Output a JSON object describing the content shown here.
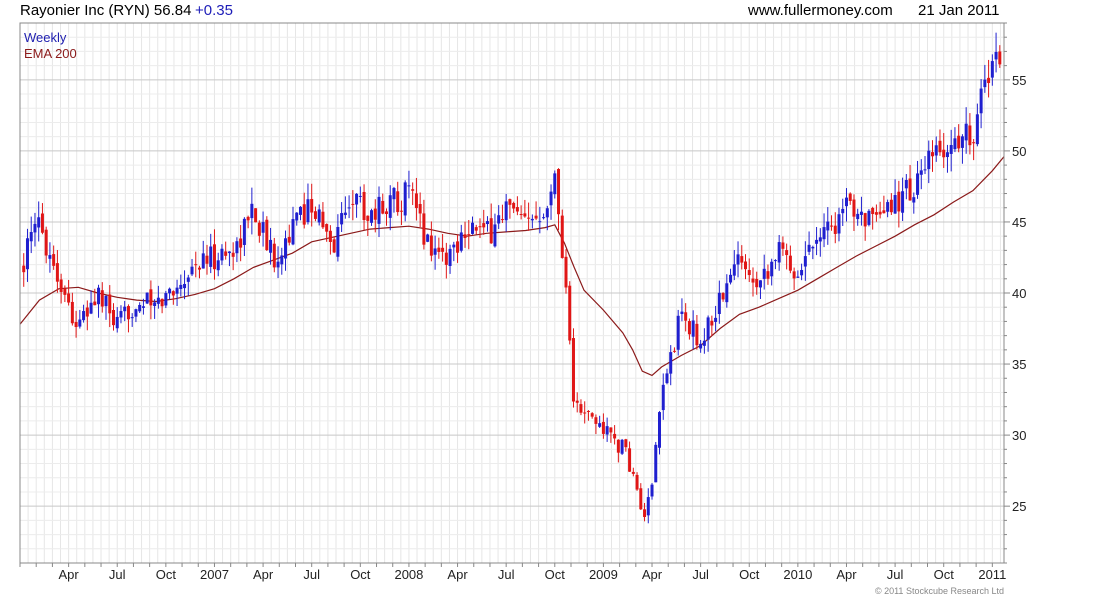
{
  "header": {
    "title": "Rayonier Inc (RYN) 56.84",
    "change": "+0.35",
    "site": "www.fullermoney.com",
    "date": "21 Jan 2011"
  },
  "footer": {
    "copyright": "© 2011 Stockcube Research Ltd"
  },
  "colors": {
    "up": "#1f1fcf",
    "down": "#e01616",
    "ema": "#8b1a1a",
    "grid": "#d4d4d4",
    "legend_weekly": "#2020b0"
  },
  "chart_data": {
    "type": "candlestick",
    "title": "Rayonier Inc (RYN) 56.84 +0.35",
    "legend": [
      "Weekly",
      "EMA 200"
    ],
    "legend_position": "top-left",
    "grid": true,
    "ylim": [
      21,
      59
    ],
    "yticks": [
      25,
      30,
      35,
      40,
      45,
      50,
      55
    ],
    "xticks": [
      "Apr",
      "Jul",
      "Oct",
      "2007",
      "Apr",
      "Jul",
      "Oct",
      "2008",
      "Apr",
      "Jul",
      "Oct",
      "2009",
      "Apr",
      "Jul",
      "Oct",
      "2010",
      "Apr",
      "Jul",
      "Oct",
      "2011"
    ],
    "xtick_times": [
      2006.25,
      2006.5,
      2006.75,
      2007.0,
      2007.25,
      2007.5,
      2007.75,
      2008.0,
      2008.25,
      2008.5,
      2008.75,
      2009.0,
      2009.25,
      2009.5,
      2009.75,
      2010.0,
      2010.25,
      2010.5,
      2010.75,
      2011.0
    ],
    "xlim": [
      2006.0,
      2011.06
    ],
    "price_series": {
      "name": "Weekly",
      "times": [
        2006.0,
        2006.1,
        2006.2,
        2006.3,
        2006.4,
        2006.5,
        2006.6,
        2006.7,
        2006.8,
        2006.9,
        2007.0,
        2007.1,
        2007.2,
        2007.3,
        2007.4,
        2007.5,
        2007.6,
        2007.7,
        2007.8,
        2007.9,
        2008.0,
        2008.1,
        2008.2,
        2008.3,
        2008.4,
        2008.5,
        2008.6,
        2008.7,
        2008.75,
        2008.8,
        2008.85,
        2008.9,
        2009.0,
        2009.1,
        2009.15,
        2009.2,
        2009.25,
        2009.3,
        2009.4,
        2009.5,
        2009.6,
        2009.7,
        2009.8,
        2009.9,
        2010.0,
        2010.1,
        2010.2,
        2010.3,
        2010.4,
        2010.5,
        2010.6,
        2010.7,
        2010.8,
        2010.9,
        2011.0,
        2011.06
      ],
      "close": [
        41.8,
        45.0,
        41.0,
        37.5,
        40.0,
        37.5,
        39.5,
        39.0,
        40.5,
        42.0,
        42.5,
        43.0,
        46.0,
        42.5,
        44.5,
        46.5,
        43.0,
        47.0,
        45.5,
        46.5,
        47.0,
        43.5,
        42.5,
        45.0,
        44.0,
        46.0,
        44.5,
        46.5,
        48.0,
        42.0,
        32.0,
        31.5,
        30.5,
        29.0,
        27.5,
        24.0,
        26.0,
        33.0,
        38.5,
        36.5,
        39.5,
        42.5,
        41.0,
        43.0,
        41.5,
        44.5,
        45.0,
        46.5,
        44.5,
        46.5,
        47.5,
        49.5,
        50.5,
        51.5,
        56.5,
        56.8
      ]
    },
    "ema_series": {
      "name": "EMA 200",
      "times": [
        2006.0,
        2006.1,
        2006.2,
        2006.3,
        2006.4,
        2006.5,
        2006.6,
        2006.7,
        2006.8,
        2006.9,
        2007.0,
        2007.1,
        2007.2,
        2007.3,
        2007.4,
        2007.5,
        2007.6,
        2007.7,
        2007.8,
        2007.9,
        2008.0,
        2008.1,
        2008.2,
        2008.3,
        2008.4,
        2008.5,
        2008.6,
        2008.7,
        2008.75,
        2008.8,
        2008.85,
        2008.9,
        2009.0,
        2009.1,
        2009.15,
        2009.2,
        2009.25,
        2009.3,
        2009.4,
        2009.5,
        2009.6,
        2009.7,
        2009.8,
        2009.9,
        2010.0,
        2010.1,
        2010.2,
        2010.3,
        2010.4,
        2010.5,
        2010.6,
        2010.7,
        2010.8,
        2010.9,
        2011.0,
        2011.06
      ],
      "values": [
        37.8,
        39.5,
        40.3,
        40.4,
        40.0,
        39.7,
        39.5,
        39.4,
        39.6,
        39.9,
        40.3,
        41.0,
        41.8,
        42.3,
        42.8,
        43.6,
        43.9,
        44.2,
        44.5,
        44.6,
        44.7,
        44.5,
        44.2,
        44.0,
        44.2,
        44.3,
        44.4,
        44.6,
        44.8,
        43.5,
        41.8,
        40.2,
        38.8,
        37.2,
        36.0,
        34.5,
        34.2,
        34.8,
        35.6,
        36.3,
        37.5,
        38.5,
        39.0,
        39.6,
        40.2,
        41.0,
        41.8,
        42.6,
        43.3,
        44.0,
        44.8,
        45.5,
        46.4,
        47.2,
        48.6,
        49.6
      ]
    }
  }
}
